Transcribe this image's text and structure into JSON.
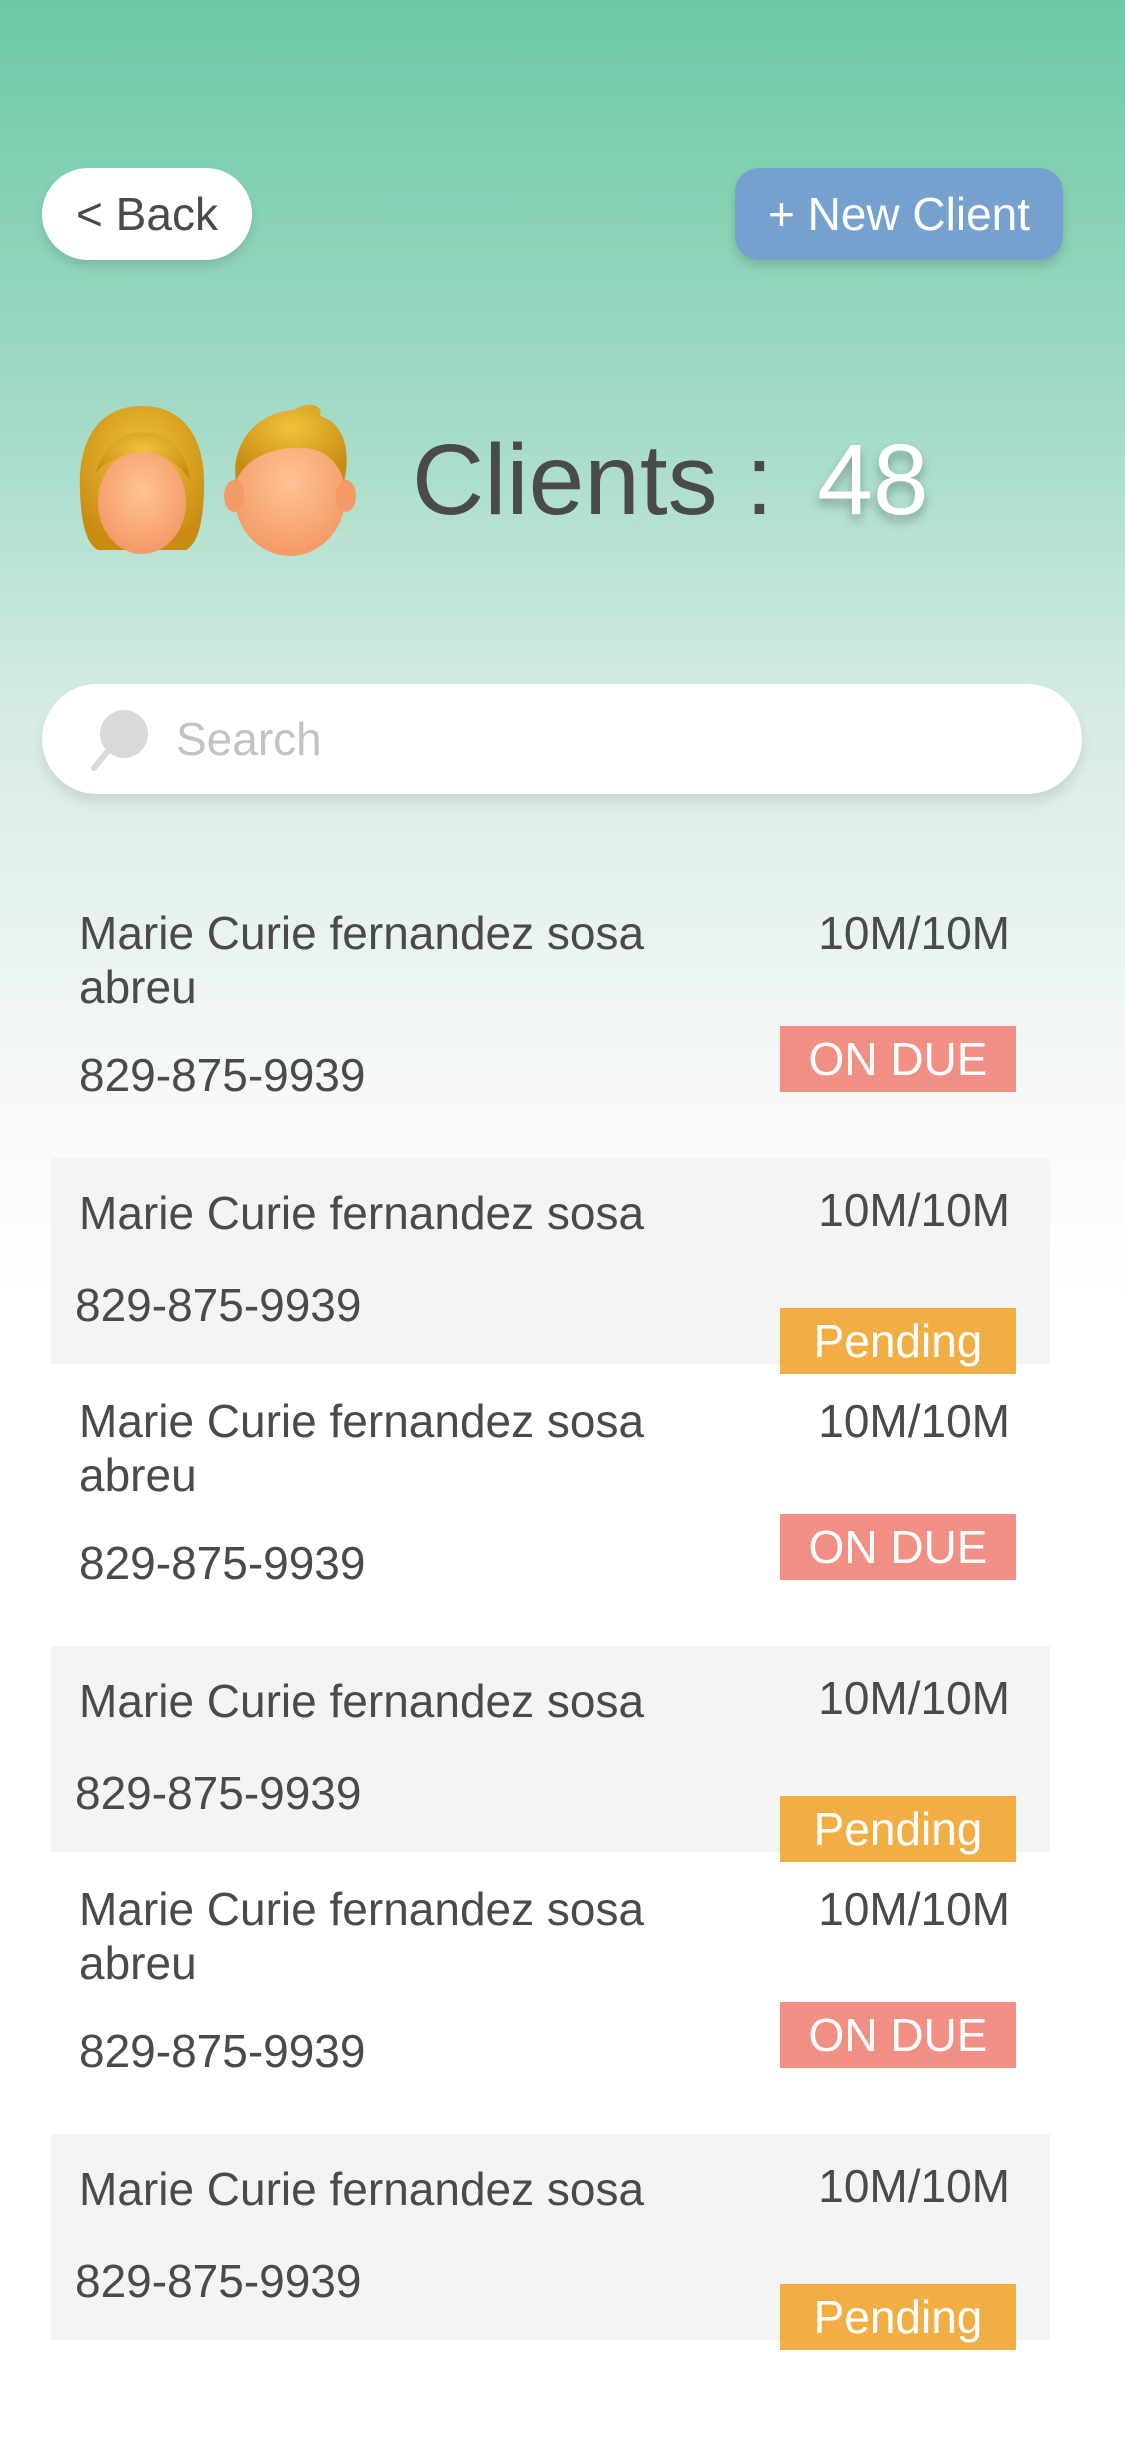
{
  "header": {
    "back_label": "< Back",
    "new_client_label": "+ New Client"
  },
  "summary": {
    "label": "Clients :",
    "count": "48"
  },
  "search": {
    "placeholder": "Search",
    "value": ""
  },
  "colors": {
    "on_due": "#f28f85",
    "pending": "#f0ae44",
    "new_client_button": "#76a1cf",
    "row_alt_bg": "#f4f4f4"
  },
  "clients": [
    {
      "name": "Marie Curie fernandez sosa abreu",
      "phone": "829-875-9939",
      "quantity": "10M/10M",
      "status": "ON DUE"
    },
    {
      "name": "Marie Curie fernandez sosa",
      "phone": "829-875-9939",
      "quantity": "10M/10M",
      "status": "Pending"
    },
    {
      "name": "Marie Curie fernandez sosa abreu",
      "phone": "829-875-9939",
      "quantity": "10M/10M",
      "status": "ON DUE"
    },
    {
      "name": "Marie Curie fernandez sosa",
      "phone": "829-875-9939",
      "quantity": "10M/10M",
      "status": "Pending"
    },
    {
      "name": "Marie Curie fernandez sosa abreu",
      "phone": "829-875-9939",
      "quantity": "10M/10M",
      "status": "ON DUE"
    },
    {
      "name": "Marie Curie fernandez sosa",
      "phone": "829-875-9939",
      "quantity": "10M/10M",
      "status": "Pending"
    }
  ]
}
